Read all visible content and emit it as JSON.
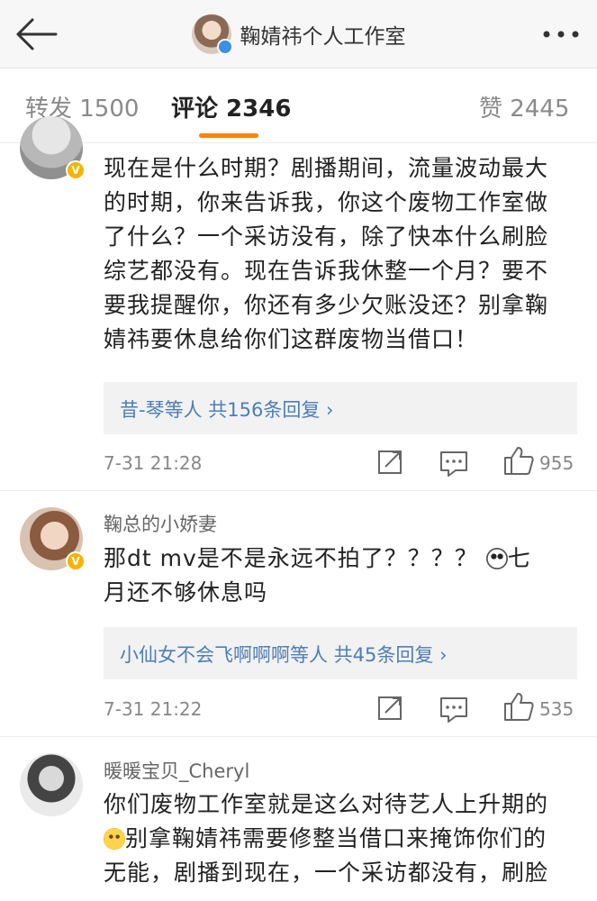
{
  "header": {
    "title": "鞠婧祎个人工作室"
  },
  "tabs": [
    {
      "label": "转发 1500"
    },
    {
      "label": "评论 2346"
    },
    {
      "label": "赞 2445"
    }
  ],
  "comments": [
    {
      "username": "",
      "lines": [
        "现在是什么时期？剧播期间，流量波动最大",
        "的时期，你来告诉我，你这个废物工作室做",
        "了什么？一个采访没有，除了快本什么刷脸",
        "综艺都没有。现在告诉我休整一个月？要不",
        "要我提醒你，你还有多少欠账没还？别拿鞠",
        "婧祎要休息给你们这群废物当借口！"
      ],
      "reply_summary": "昔-琴等人  共156条回复 ›",
      "time": "7-31 21:28",
      "likes": "955"
    },
    {
      "username": "鞠总的小娇妻",
      "line1_before": "那dt  mv是不是永远不拍了？？？？",
      "line1_after": "七",
      "line2": "月还不够休息吗",
      "reply_summary": "小仙女不会飞啊啊啊等人  共45条回复 ›",
      "time": "7-31 21:22",
      "likes": "535"
    },
    {
      "username": "暖暖宝贝_Cheryl",
      "line1": "你们废物工作室就是这么对待艺人上升期的",
      "line2_after": "别拿鞠婧祎需要修整当借口来掩饰你们的",
      "line3": "无能，剧播到现在，一个采访都没有，刷脸"
    }
  ],
  "colors": {
    "accent": "#ff8200",
    "link": "#4d7eb6",
    "verified_gold": "#f5b400",
    "verified_blue": "#3d8fe0"
  },
  "icons": [
    "back-arrow-icon",
    "more-dots-icon",
    "share-icon",
    "comment-icon",
    "like-icon",
    "verified-badge-icon"
  ]
}
